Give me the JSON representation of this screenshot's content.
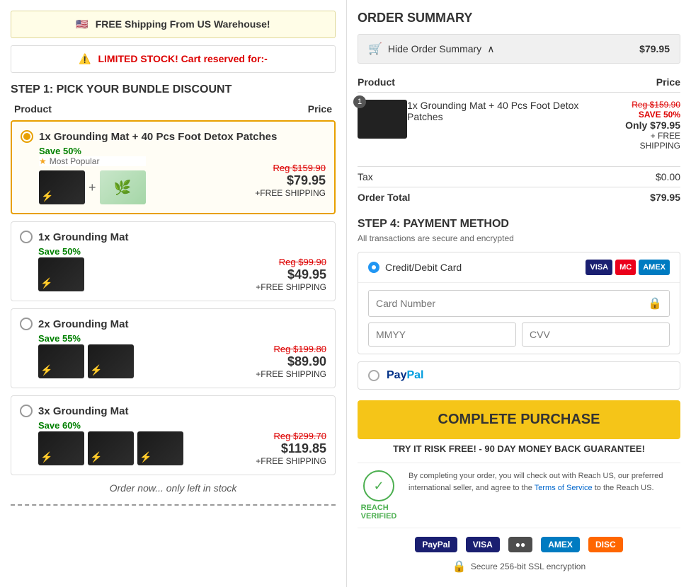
{
  "left": {
    "shipping_banner": "FREE Shipping From US Warehouse!",
    "stock_banner": "LIMITED STOCK! Cart reserved for:-",
    "section_title": "STEP 1: PICK YOUR BUNDLE DISCOUNT",
    "col_product": "Product",
    "col_price": "Price",
    "options": [
      {
        "id": "opt1",
        "selected": true,
        "title": "1x Grounding Mat + 40 Pcs Foot Detox Patches",
        "save": "Save 50%",
        "popular": "Most Popular",
        "reg_price": "Reg $159.90",
        "sale_price": "$79.95",
        "shipping": "+FREE SHIPPING",
        "mat_count": 1,
        "has_patches": true
      },
      {
        "id": "opt2",
        "selected": false,
        "title": "1x Grounding Mat",
        "save": "Save 50%",
        "popular": "",
        "reg_price": "Reg $99.90",
        "sale_price": "$49.95",
        "shipping": "+FREE SHIPPING",
        "mat_count": 1,
        "has_patches": false
      },
      {
        "id": "opt3",
        "selected": false,
        "title": "2x Grounding Mat",
        "save": "Save 55%",
        "popular": "",
        "reg_price": "Reg $199.80",
        "sale_price": "$89.90",
        "shipping": "+FREE SHIPPING",
        "mat_count": 2,
        "has_patches": false
      },
      {
        "id": "opt4",
        "selected": false,
        "title": "3x Grounding Mat",
        "save": "Save 60%",
        "popular": "",
        "reg_price": "Reg $299.70",
        "sale_price": "$119.85",
        "shipping": "+FREE SHIPPING",
        "mat_count": 3,
        "has_patches": false
      }
    ],
    "order_now": "Order now... only left in stock"
  },
  "right": {
    "order_summary_title": "ORDER SUMMARY",
    "toggle_label": "Hide Order Summary",
    "toggle_price": "$79.95",
    "col_product": "Product",
    "col_price": "Price",
    "item": {
      "qty": "1",
      "title": "1x Grounding Mat + 40 Pcs Foot Detox Patches",
      "reg_price": "Reg $159.90",
      "save": "SAVE 50%",
      "only_price": "Only $79.95",
      "shipping": "+ FREE SHIPPING"
    },
    "tax_label": "Tax",
    "tax_value": "$0.00",
    "total_label": "Order Total",
    "total_value": "$79.95",
    "payment_title": "STEP 4: PAYMENT METHOD",
    "payment_subtitle": "All transactions are secure and encrypted",
    "credit_label": "Credit/Debit Card",
    "card_number_placeholder": "Card Number",
    "mmyy_placeholder": "MMYY",
    "cvv_placeholder": "CVV",
    "paypal_label": "PayPal",
    "purchase_btn": "COMPLETE PURCHASE",
    "purchase_sub": "TRY IT RISK FREE! - 90 DAY MONEY BACK GUARANTEE!",
    "reach_desc1": "By completing your order, you will check out with Reach US, our preferred international seller, and agree to the",
    "reach_tos": "Terms of Service",
    "reach_desc2": "to the Reach US.",
    "ssl_text": "Secure 256-bit SSL encryption"
  }
}
